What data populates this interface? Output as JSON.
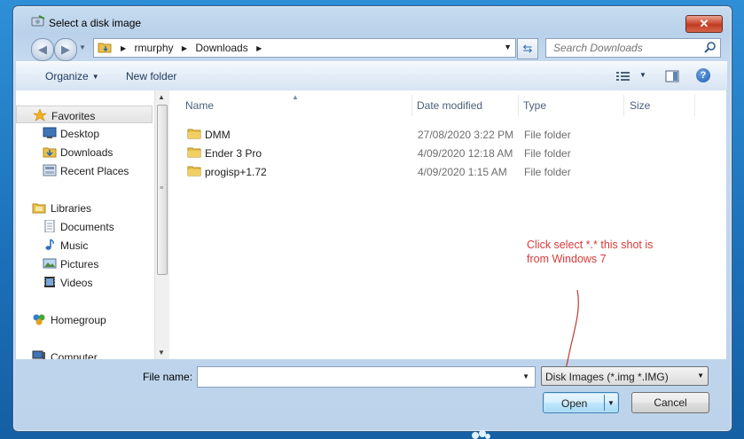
{
  "window": {
    "title": "Select a disk image",
    "close_glyph": "✕",
    "title_icon": "disk-image-icon"
  },
  "address_bar": {
    "breadcrumbs": [
      "rmurphy",
      "Downloads"
    ],
    "back_glyph": "◀",
    "forward_glyph": "▶",
    "refresh_glyph": "⇆"
  },
  "search": {
    "placeholder": "Search Downloads",
    "icon": "search-icon"
  },
  "toolbar": {
    "organize_label": "Organize",
    "new_folder_label": "New folder",
    "help_glyph": "?"
  },
  "nav_pane": {
    "items": [
      {
        "label": "Favorites",
        "icon": "star-icon",
        "group": true
      },
      {
        "label": "Desktop",
        "icon": "desktop-icon",
        "group": false
      },
      {
        "label": "Downloads",
        "icon": "downloads-icon",
        "group": false
      },
      {
        "label": "Recent Places",
        "icon": "recent-places-icon",
        "group": false
      },
      {
        "label": "Libraries",
        "icon": "libraries-icon",
        "group": true
      },
      {
        "label": "Documents",
        "icon": "documents-icon",
        "group": false
      },
      {
        "label": "Music",
        "icon": "music-icon",
        "group": false
      },
      {
        "label": "Pictures",
        "icon": "pictures-icon",
        "group": false
      },
      {
        "label": "Videos",
        "icon": "videos-icon",
        "group": false
      },
      {
        "label": "Homegroup",
        "icon": "homegroup-icon",
        "group": true
      },
      {
        "label": "Computer",
        "icon": "computer-icon",
        "group": true
      }
    ]
  },
  "file_list": {
    "columns": [
      "Name",
      "Date modified",
      "Type",
      "Size"
    ],
    "rows": [
      {
        "name": "DMM",
        "date": "27/08/2020 3:22 PM",
        "type": "File folder",
        "size": ""
      },
      {
        "name": "Ender 3 Pro",
        "date": "4/09/2020 12:18 AM",
        "type": "File folder",
        "size": ""
      },
      {
        "name": "progisp+1.72",
        "date": "4/09/2020 1:15 AM",
        "type": "File folder",
        "size": ""
      }
    ]
  },
  "annotation": {
    "text": "Click select *.* this shot is from Windows 7",
    "color": "#d83a3a"
  },
  "bottom": {
    "file_name_label": "File name:",
    "file_name_value": "",
    "filter_selected": "Disk Images (*.img *.IMG)",
    "open_label": "Open",
    "cancel_label": "Cancel"
  },
  "colors": {
    "desktop_blue": "#1b6fb8",
    "window_frame": "#b9d1ea",
    "close_red": "#c13a22",
    "folder_yellow": "#e8c04a"
  }
}
